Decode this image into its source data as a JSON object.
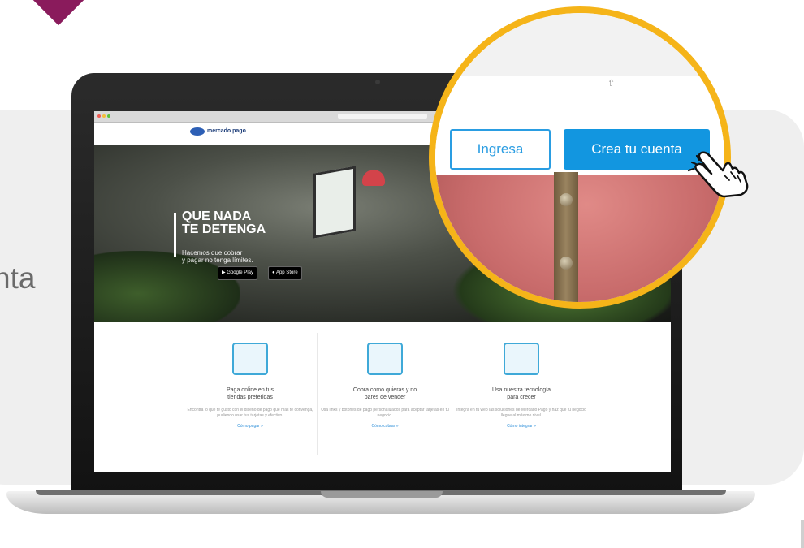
{
  "side_text": {
    "line1": ":",
    "line2": "nta"
  },
  "colors": {
    "accent_purple": "#8a1b5c",
    "brand_blue": "#1296e0",
    "ring_yellow": "#f5b419"
  },
  "site": {
    "logo_text": "mercado pago",
    "hero": {
      "title_line1": "QUE NADA",
      "title_line2": "TE DETENGA",
      "subtitle_line1": "Hacemos que cobrar",
      "subtitle_line2": "y pagar no tenga límites.",
      "google_play": "Google Play",
      "app_store": "App Store"
    },
    "features": [
      {
        "title_line1": "Paga online en tus",
        "title_line2": "tiendas preferidas",
        "desc": "Encontrá lo que te gustó con el diseño de pago que más te convenga, pudiendo usar tus tarjetas y efectivo.",
        "link": "Cómo pagar »",
        "icon": "shopping-bag-icon"
      },
      {
        "title_line1": "Cobra como quieras y no",
        "title_line2": "pares de vender",
        "desc": "Usa links y botones de pago personalizados para aceptar tarjetas en tu negocio.",
        "link": "Cómo cobrar »",
        "icon": "payment-link-icon"
      },
      {
        "title_line1": "Usa nuestra tecnología",
        "title_line2": "para crecer",
        "desc": "Integra en tu web las soluciones de Mercado Pago y haz que tu negocio llegue al máximo nivel.",
        "link": "Cómo integrar »",
        "icon": "cart-icon"
      }
    ]
  },
  "zoom": {
    "share_icon": "share-icon",
    "ingresa_label": "Ingresa",
    "crea_label": "Crea tu cuenta"
  }
}
